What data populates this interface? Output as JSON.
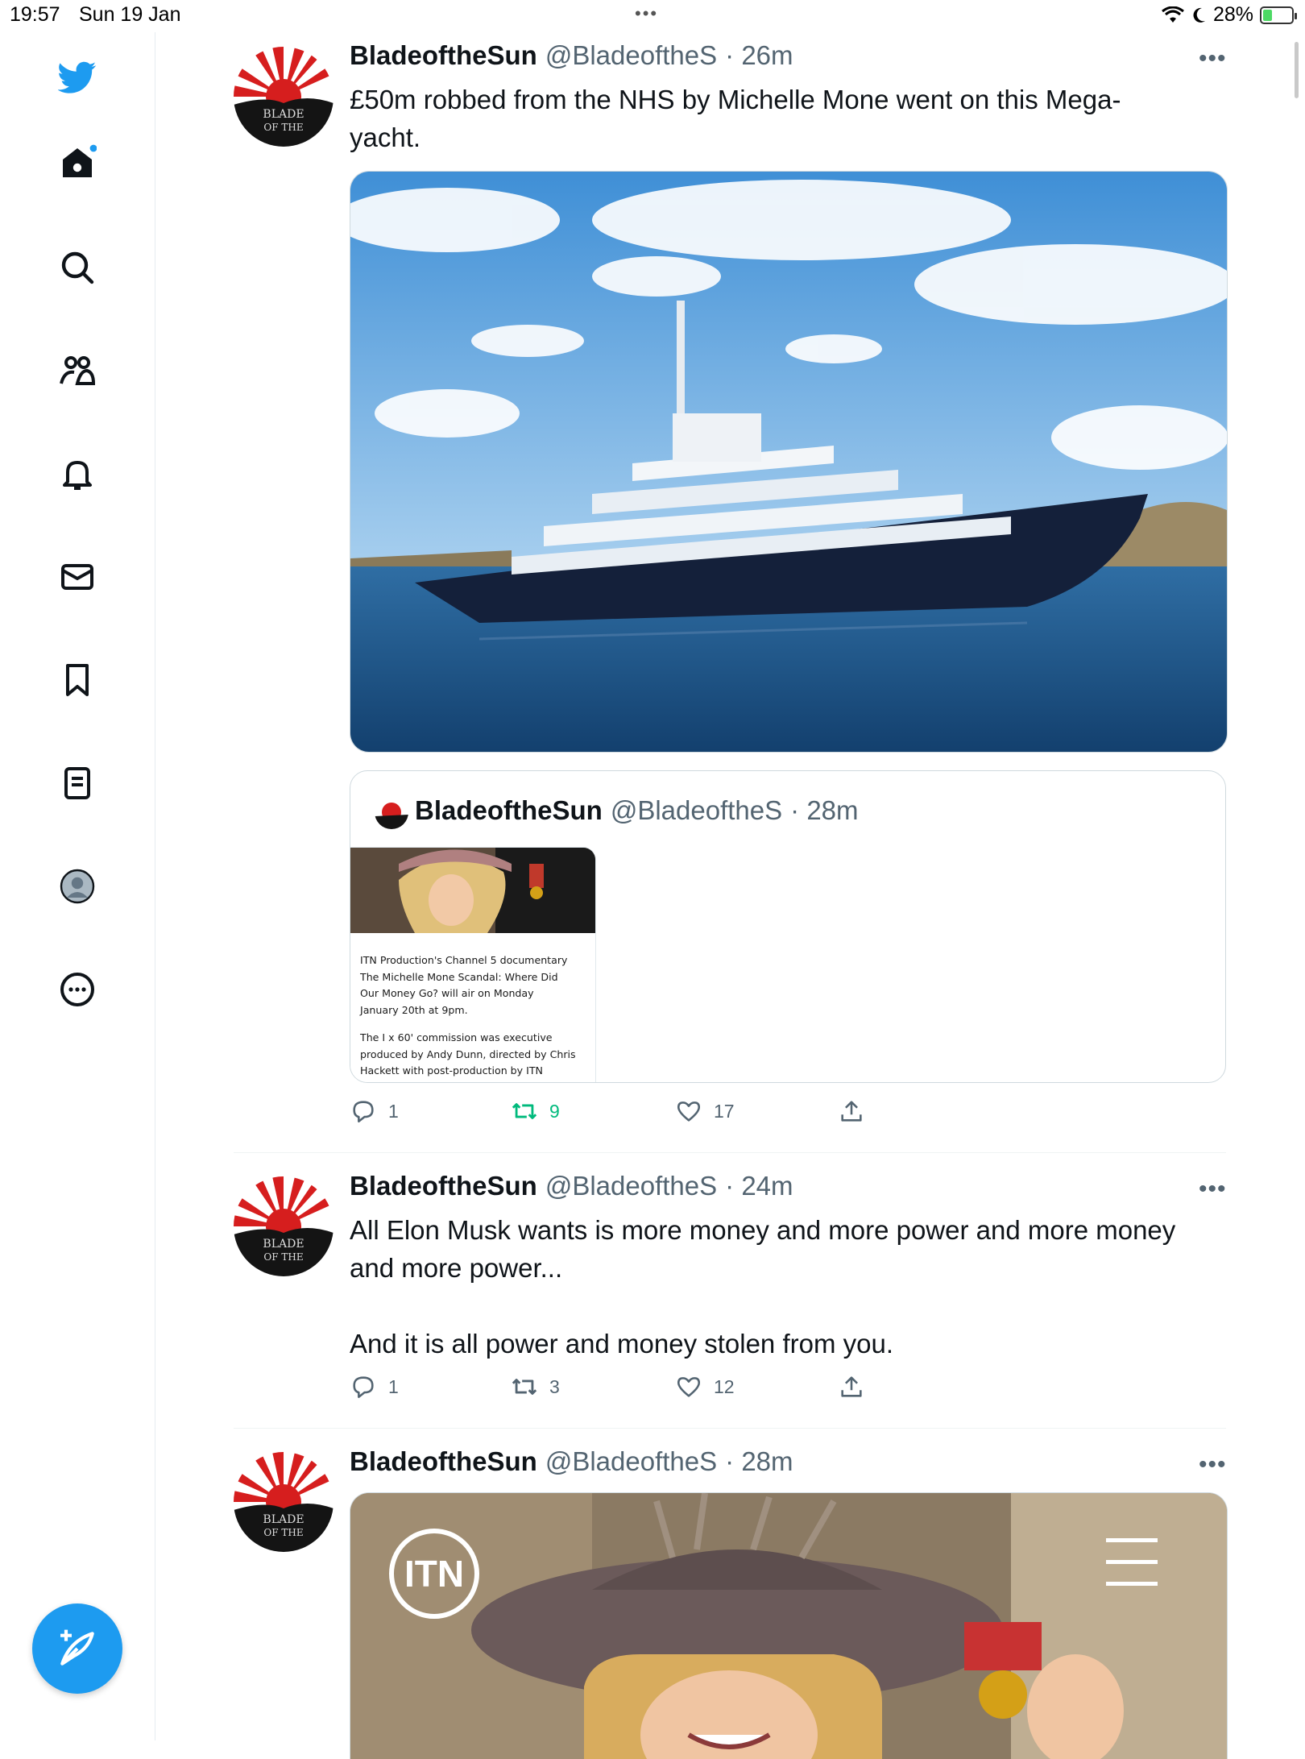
{
  "status_bar": {
    "time": "19:57",
    "date": "Sun 19 Jan",
    "battery": "28%",
    "battery_level": 0.28
  },
  "nav_icons": [
    "twitter-logo-icon",
    "home-icon",
    "search-icon",
    "communities-icon",
    "notifications-icon",
    "messages-icon",
    "bookmarks-icon",
    "lists-icon",
    "profile-icon",
    "more-icon"
  ],
  "compose_icon": "compose-tweet-icon",
  "tweets": [
    {
      "name": "BladeoftheSun",
      "handle": "@BladeoftheS",
      "time": "· 26m",
      "text_lines": [
        "£50m robbed from the NHS by Michelle Mone went on this Mega-",
        "yacht."
      ],
      "quote": {
        "name": "BladeoftheSun",
        "handle": "@BladeoftheS",
        "time": "· 28m",
        "card_lines": [
          "ITN Production's Channel 5 documentary",
          "The Michelle Mone Scandal: Where Did",
          "Our Money Go? will air on Monday",
          "January 20th at 9pm.",
          "The I x 60' commission was executive",
          "produced by Andy Dunn, directed by Chris",
          "Hackett with post-production by ITN"
        ]
      },
      "replies": "1",
      "retweets": "9",
      "likes": "17"
    },
    {
      "name": "BladeoftheSun",
      "handle": "@BladeoftheS",
      "time": "· 24m",
      "text_lines": [
        "All Elon Musk wants is more money and more power and more money",
        "and more power...",
        "",
        "And it is all power and money stolen from you."
      ],
      "replies": "1",
      "retweets": "3",
      "likes": "12"
    },
    {
      "name": "BladeoftheSun",
      "handle": "@BladeoftheS",
      "time": "· 28m",
      "media_logo": "ITN"
    }
  ],
  "colors": {
    "accent": "#1d9bf0",
    "retweet_active": "#00ba7c",
    "muted": "#536471"
  }
}
